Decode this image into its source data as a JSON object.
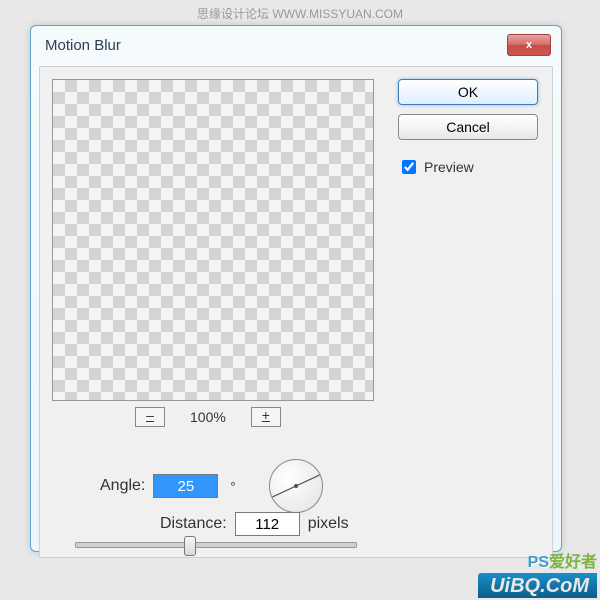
{
  "watermark": {
    "top": "思缘设计论坛   WWW.MISSYUAN.COM",
    "right_ps": "PS",
    "right_cn": "爱好者",
    "bottom": "UiBQ.CoM"
  },
  "dialog": {
    "title": "Motion Blur",
    "close_x": "x",
    "buttons": {
      "ok": "OK",
      "cancel": "Cancel"
    },
    "preview_label": "Preview",
    "preview_checked": true,
    "zoom": {
      "out": "–",
      "level": "100%",
      "in": "+"
    },
    "angle": {
      "label": "Angle:",
      "value": "25",
      "unit": "°"
    },
    "distance": {
      "label": "Distance:",
      "value": "112",
      "unit": "pixels"
    }
  }
}
